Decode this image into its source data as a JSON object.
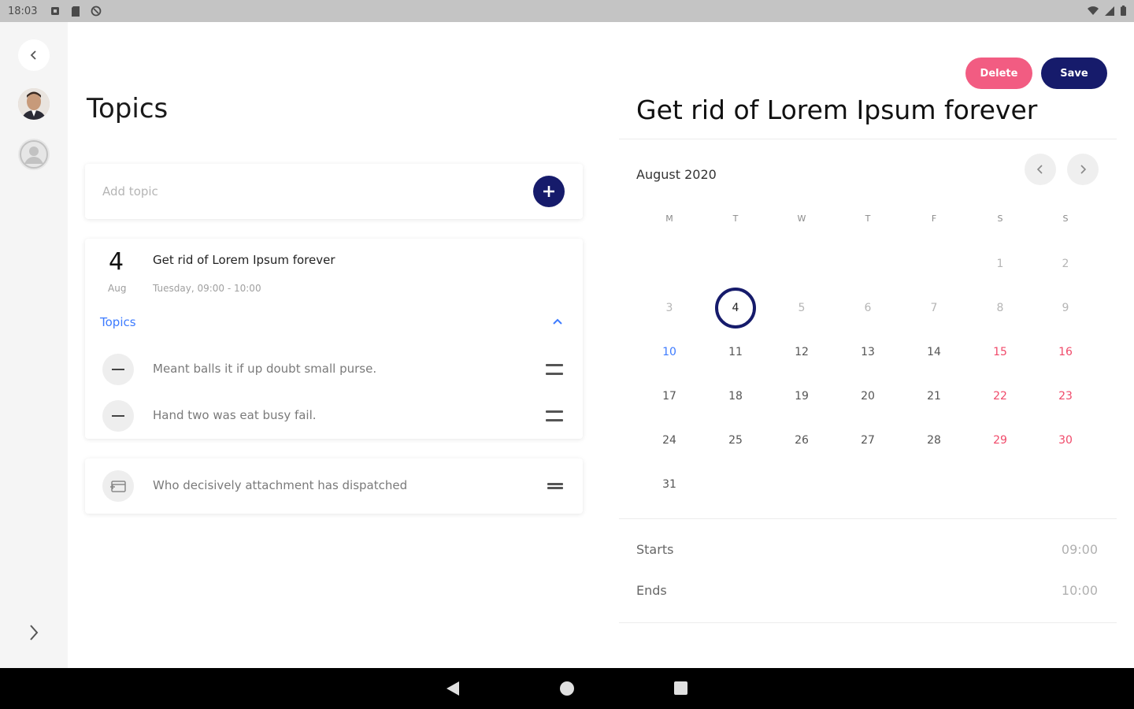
{
  "status_bar": {
    "time": "18:03"
  },
  "rail": {},
  "topics_panel": {
    "title": "Topics",
    "add_placeholder": "Add topic",
    "event": {
      "day": "4",
      "month": "Aug",
      "title": "Get rid of Lorem Ipsum forever",
      "time": "Tuesday, 09:00 - 10:00",
      "topics_label": "Topics",
      "items": [
        {
          "text": "Meant balls it if up doubt small purse."
        },
        {
          "text": "Hand two was eat busy fail."
        }
      ]
    },
    "unscheduled": {
      "text": "Who decisively attachment has dispatched"
    }
  },
  "detail": {
    "delete_label": "Delete",
    "save_label": "Save",
    "title": "Get rid of Lorem Ipsum forever",
    "calendar": {
      "month_label": "August 2020",
      "weekdays": [
        "M",
        "T",
        "W",
        "T",
        "F",
        "S",
        "S"
      ],
      "selected_day": "4",
      "today_day": "10"
    },
    "starts_label": "Starts",
    "starts_value": "09:00",
    "ends_label": "Ends",
    "ends_value": "10:00"
  },
  "colors": {
    "primary": "#161b6b",
    "delete": "#f25c82",
    "weekend": "#f04a6a",
    "link": "#3d7bff"
  }
}
